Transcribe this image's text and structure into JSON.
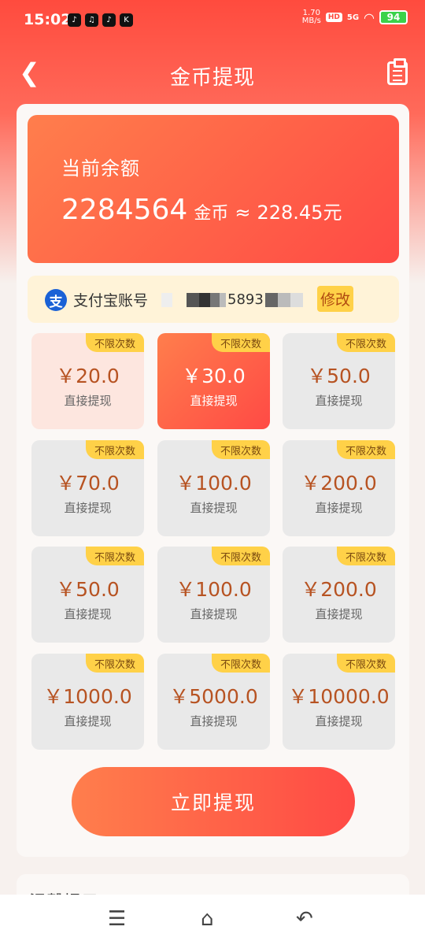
{
  "status": {
    "time": "15:02",
    "apps": [
      "♪",
      "♫",
      "♪",
      "K"
    ],
    "speed_top": "1.70",
    "speed_bottom": "MB/s",
    "hd": "HD",
    "signal": "5G",
    "battery": "94"
  },
  "header": {
    "title": "金币提现"
  },
  "balance": {
    "label": "当前余额",
    "coins": "2284564",
    "unit": "金币",
    "approx": "≈",
    "money": "228.45元"
  },
  "account": {
    "icon_text": "支",
    "label": "支付宝账号",
    "visible_digits": "5893",
    "edit_label": "修改"
  },
  "options": [
    {
      "badge": "不限次数",
      "amount": "￥20.0",
      "sub": "直接提现"
    },
    {
      "badge": "不限次数",
      "amount": "￥30.0",
      "sub": "直接提现"
    },
    {
      "badge": "不限次数",
      "amount": "￥50.0",
      "sub": "直接提现"
    },
    {
      "badge": "不限次数",
      "amount": "￥70.0",
      "sub": "直接提现"
    },
    {
      "badge": "不限次数",
      "amount": "￥100.0",
      "sub": "直接提现"
    },
    {
      "badge": "不限次数",
      "amount": "￥200.0",
      "sub": "直接提现"
    },
    {
      "badge": "不限次数",
      "amount": "￥50.0",
      "sub": "直接提现"
    },
    {
      "badge": "不限次数",
      "amount": "￥100.0",
      "sub": "直接提现"
    },
    {
      "badge": "不限次数",
      "amount": "￥200.0",
      "sub": "直接提现"
    },
    {
      "badge": "不限次数",
      "amount": "￥1000.0",
      "sub": "直接提现"
    },
    {
      "badge": "不限次数",
      "amount": "￥5000.0",
      "sub": "直接提现"
    },
    {
      "badge": "不限次数",
      "amount": "￥10000.0",
      "sub": "直接提现"
    }
  ],
  "submit_label": "立即提现",
  "tips_title": "温馨提示",
  "icons": {
    "back": "chevron-left-icon",
    "records": "clipboard-icon",
    "menu": "menu-icon",
    "home": "home-icon",
    "return": "back-icon"
  }
}
